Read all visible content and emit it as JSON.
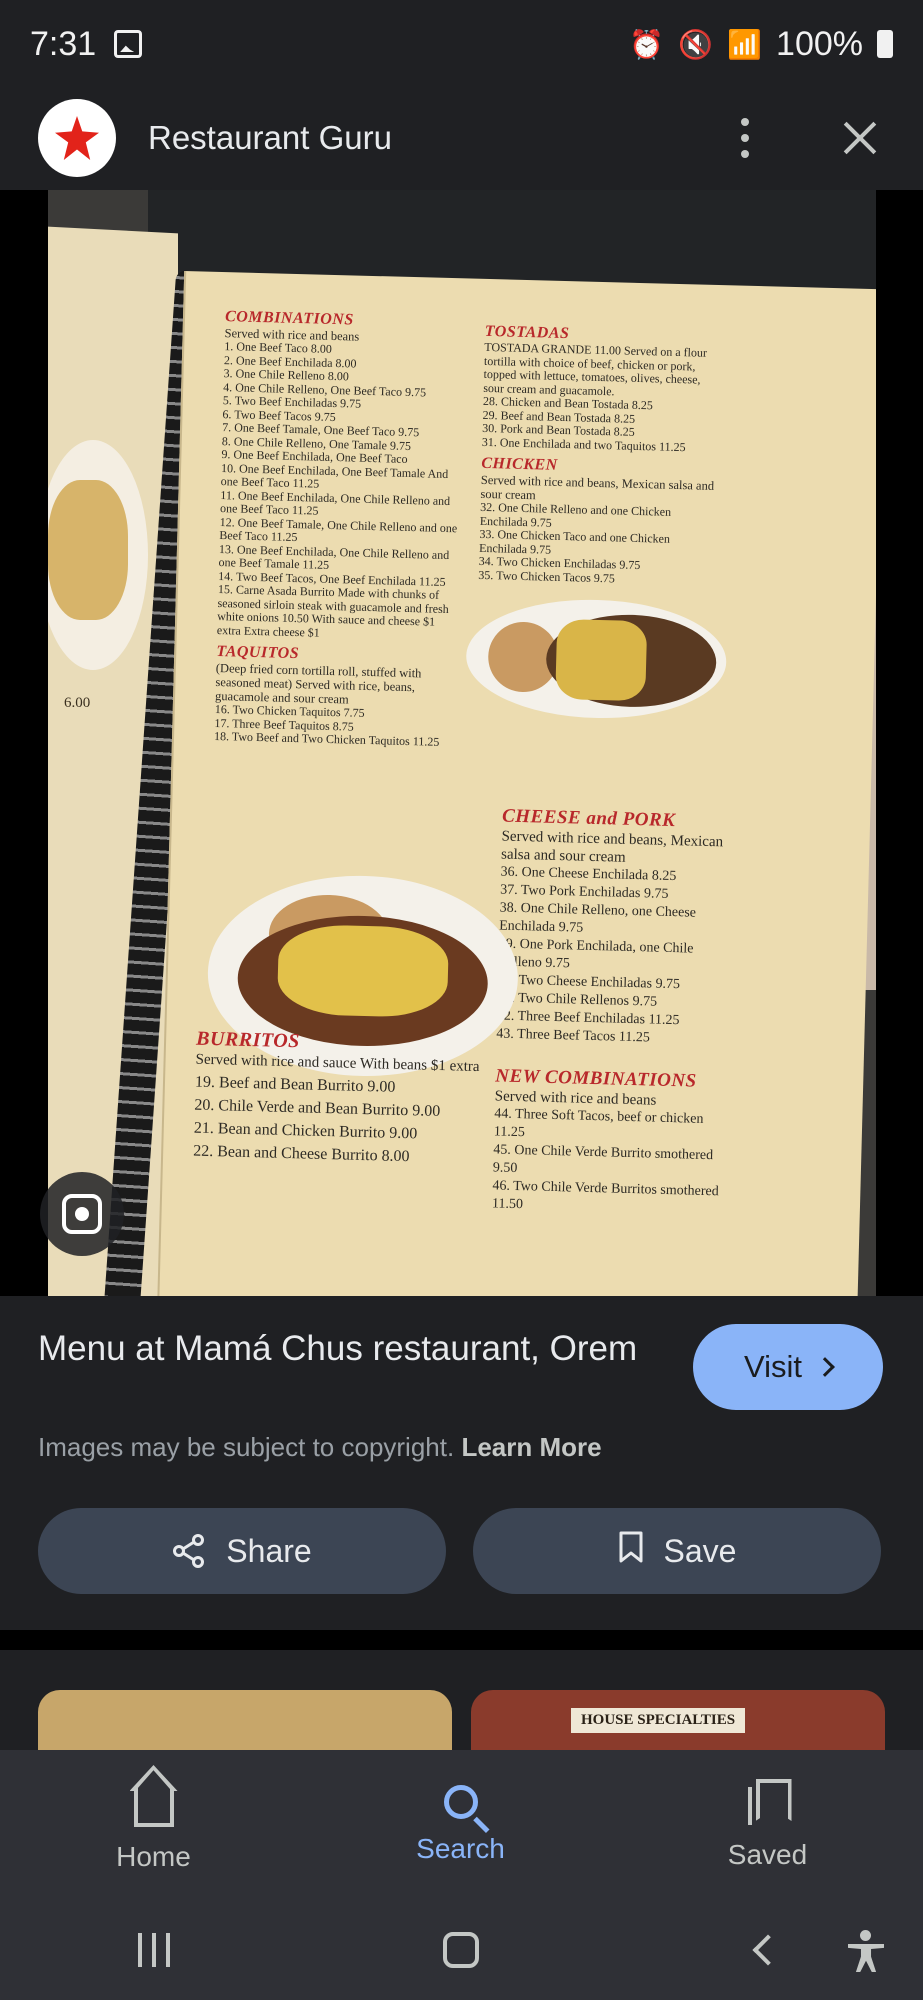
{
  "status_bar": {
    "time": "7:31",
    "battery": "100%",
    "icons": [
      "image-icon",
      "alarm-icon",
      "mute-icon",
      "wifi-icon",
      "signal-icon",
      "battery-icon"
    ]
  },
  "header": {
    "app_name": "Restaurant Guru",
    "logo_icon": "restaurant-guru-logo",
    "brand_color": "#e2231a"
  },
  "image": {
    "menu": {
      "combinations": {
        "title": "COMBINATIONS",
        "subtitle": "Served with rice and beans",
        "items": [
          "1. One Beef Taco 8.00",
          "2. One Beef Enchilada 8.00",
          "3. One Chile Relleno 8.00",
          "4. One Chile Relleno, One Beef Taco 9.75",
          "5. Two Beef Enchiladas 9.75",
          "6. Two Beef Tacos 9.75",
          "7. One Beef Tamale, One Beef Taco 9.75",
          "8. One Chile Relleno, One Tamale 9.75",
          "9. One Beef Enchilada, One Beef Taco",
          "10. One Beef Enchilada, One Beef Tamale And one Beef Taco 11.25",
          "11. One Beef Enchilada, One Chile Relleno and one Beef Taco 11.25",
          "12. One Beef Tamale, One Chile Relleno and one Beef Taco 11.25",
          "13. One Beef Enchilada, One Chile Relleno and one Beef Tamale 11.25",
          "14. Two Beef Tacos, One Beef Enchilada 11.25",
          "15. Carne Asada Burrito Made with chunks of seasoned sirloin steak with guacamole and fresh white onions 10.50 With sauce and cheese $1 extra Extra cheese $1"
        ]
      },
      "taquitos": {
        "title": "TAQUITOS",
        "subtitle": "(Deep fried corn tortilla roll, stuffed with seasoned meat) Served with rice, beans, guacamole and sour cream",
        "items": [
          "16. Two Chicken Taquitos 7.75",
          "17. Three Beef Taquitos 8.75",
          "18. Two Beef and Two Chicken Taquitos 11.25"
        ]
      },
      "tostadas": {
        "title": "TOSTADAS",
        "subtitle": "TOSTADA GRANDE 11.00 Served on a flour tortilla with choice of beef, chicken or pork, topped with lettuce, tomatoes, olives, cheese, sour cream and guacamole.",
        "items": [
          "28. Chicken and Bean Tostada 8.25",
          "29. Beef and Bean Tostada 8.25",
          "30. Pork and Bean Tostada 8.25",
          "31. One Enchilada and two Taquitos 11.25"
        ]
      },
      "chicken": {
        "title": "CHICKEN",
        "subtitle": "Served with rice and beans, Mexican salsa and sour cream",
        "items": [
          "32. One Chile Relleno and one Chicken Enchilada 9.75",
          "33. One Chicken Taco and one Chicken Enchilada 9.75",
          "34. Two Chicken Enchiladas 9.75",
          "35. Two Chicken Tacos 9.75"
        ]
      },
      "cheese_pork": {
        "title": "CHEESE and PORK",
        "subtitle": "Served with rice and beans, Mexican salsa and sour cream",
        "items": [
          "36. One Cheese Enchilada 8.25",
          "37. Two Pork Enchiladas 9.75",
          "38. One Chile Relleno, one Cheese Enchilada 9.75",
          "39. One Pork Enchilada, one Chile Relleno 9.75",
          "40. Two Cheese Enchiladas 9.75",
          "41. Two Chile Rellenos 9.75",
          "42. Three Beef Enchiladas 11.25",
          "43. Three Beef Tacos 11.25"
        ]
      },
      "new_combinations": {
        "title": "NEW COMBINATIONS",
        "subtitle": "Served with rice and beans",
        "items": [
          "44. Three Soft Tacos, beef or chicken 11.25",
          "45. One Chile Verde Burrito smothered 9.50",
          "46. Two Chile Verde Burritos smothered 11.50"
        ]
      },
      "burritos": {
        "title": "BURRITOS",
        "subtitle": "Served with rice and sauce With beans $1 extra",
        "items": [
          "19. Beef and Bean Burrito 9.00",
          "20. Chile Verde and Bean Burrito 9.00",
          "21. Bean and Chicken Burrito 9.00",
          "22. Bean and Cheese Burrito 8.00"
        ]
      },
      "left_page_price": "6.00"
    },
    "lens_icon": "google-lens-icon"
  },
  "info": {
    "title": "Menu at Mamá Chus restaurant, Orem",
    "visit_label": "Visit",
    "copyright_text": "Images may be subject to copyright.",
    "learn_more": "Learn More",
    "share_label": "Share",
    "save_label": "Save",
    "accent_color": "#8ab4f8"
  },
  "related": {
    "thumb_2_label": "HOUSE SPECIALTIES"
  },
  "bottom_nav": {
    "items": [
      {
        "label": "Home",
        "icon": "home-icon"
      },
      {
        "label": "Search",
        "icon": "search-icon",
        "active": true
      },
      {
        "label": "Saved",
        "icon": "saved-icon"
      }
    ]
  }
}
